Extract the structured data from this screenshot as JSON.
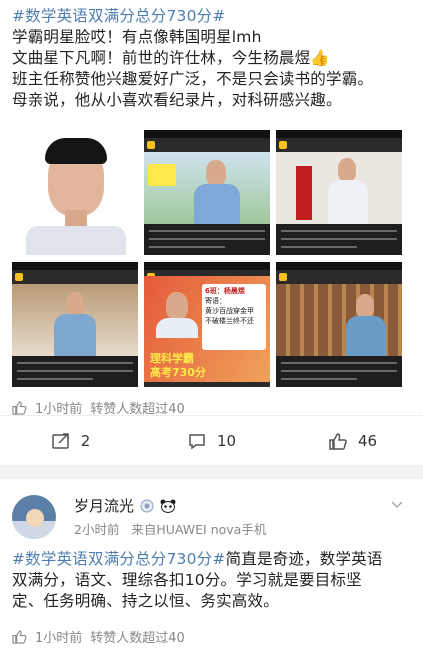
{
  "post1": {
    "lines": [
      {
        "hashtag": "#数学英语双满分总分730分#",
        "text": ""
      },
      {
        "hashtag": "",
        "text": "学霸明星脸哎！有点像韩国明星lmh"
      },
      {
        "hashtag": "",
        "text": "文曲星下凡啊！前世的许仕林，今生杨晨煜👍"
      },
      {
        "hashtag": "",
        "text": "班主任称赞他兴趣爱好广泛，不是只会读书的学霸。"
      },
      {
        "hashtag": "",
        "text": "母亲说，他从小喜欢看纪录片，对科研感兴趣。"
      }
    ],
    "thumb_texts": {
      "t5_name": "6班：杨晨煜",
      "t5_label": "寄语：",
      "t5_quote1": "黄沙百战穿金甲",
      "t5_quote2": "不破楼兰终不还",
      "t5_headline1": "理科学霸",
      "t5_headline2": "高考730分"
    },
    "meta": {
      "time": "1小时前",
      "forwards": "转赞人数超过40"
    },
    "actions": {
      "repost": "2",
      "comments": "10",
      "likes": "46"
    }
  },
  "post2": {
    "username": "岁月流光",
    "time": "2小时前",
    "source": "来自HUAWEI nova手机",
    "lines": [
      {
        "hashtag": "#数学英语双满分总分730分#",
        "text": "简直是奇迹，数学英语"
      },
      {
        "hashtag": "",
        "text": "双满分，语文、理综各扣10分。学习就是要目标坚"
      },
      {
        "hashtag": "",
        "text": "定、任务明确、持之以恒、务实高效。"
      }
    ],
    "meta": {
      "time": "1小时前",
      "forwards": "转赞人数超过40"
    }
  },
  "colors": {
    "hashtag": "#507daf",
    "meta": "#888888",
    "background": "#f2f2f2"
  }
}
